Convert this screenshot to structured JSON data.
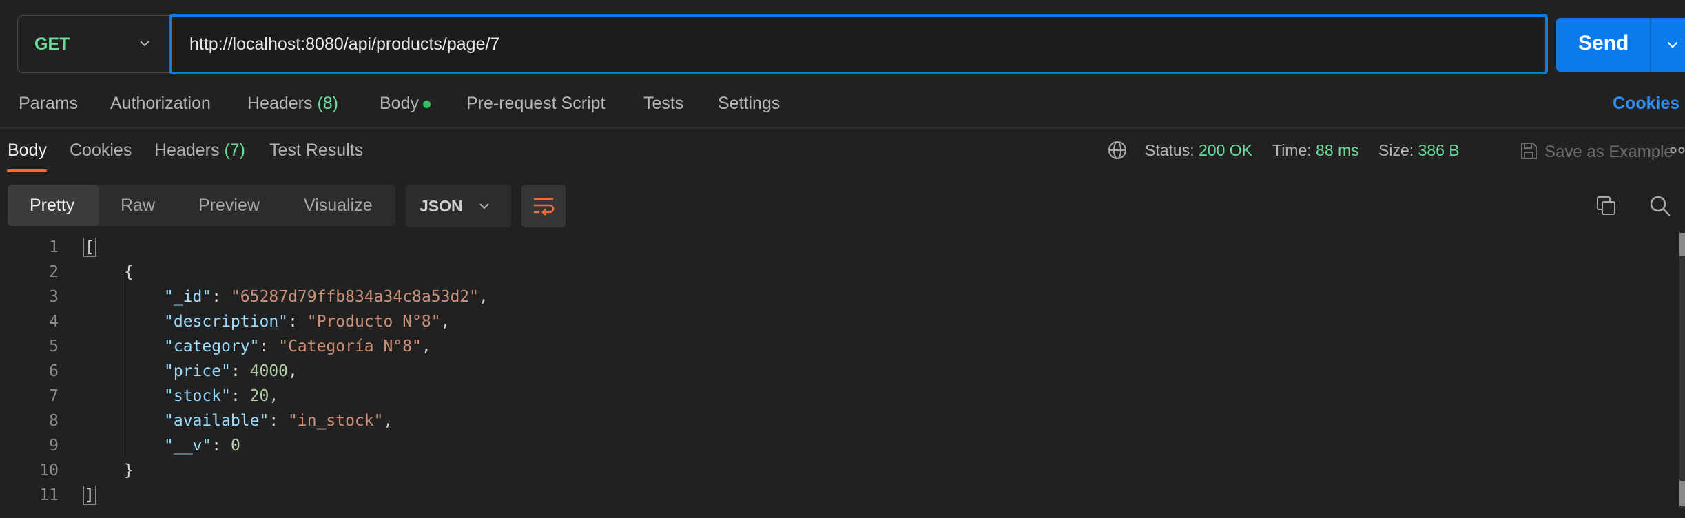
{
  "request": {
    "method": "GET",
    "url": "http://localhost:8080/api/products/page/7",
    "send_label": "Send",
    "tabs": [
      {
        "label": "Params"
      },
      {
        "label": "Authorization"
      },
      {
        "label": "Headers",
        "count": "(8)"
      },
      {
        "label": "Body"
      },
      {
        "label": "Pre-request Script"
      },
      {
        "label": "Tests"
      },
      {
        "label": "Settings"
      }
    ],
    "cookies_label": "Cookies"
  },
  "response": {
    "tabs": [
      {
        "label": "Body"
      },
      {
        "label": "Cookies"
      },
      {
        "label": "Headers",
        "count": "(7)"
      },
      {
        "label": "Test Results"
      }
    ],
    "status_label": "Status:",
    "status_value": "200 OK",
    "time_label": "Time:",
    "time_value": "88 ms",
    "size_label": "Size:",
    "size_value": "386 B",
    "save_example_label": "Save as Example",
    "views": [
      {
        "label": "Pretty"
      },
      {
        "label": "Raw"
      },
      {
        "label": "Preview"
      },
      {
        "label": "Visualize"
      }
    ],
    "format": "JSON"
  },
  "editor": {
    "line_numbers": [
      "1",
      "2",
      "3",
      "4",
      "5",
      "6",
      "7",
      "8",
      "9",
      "10",
      "11"
    ],
    "fields": {
      "id_key": "\"_id\"",
      "id_val": "\"65287d79ffb834a34c8a53d2\"",
      "desc_key": "\"description\"",
      "desc_val": "\"Producto N°8\"",
      "cat_key": "\"category\"",
      "cat_val": "\"Categoría N°8\"",
      "price_key": "\"price\"",
      "price_val": "4000",
      "stock_key": "\"stock\"",
      "stock_val": "20",
      "avail_key": "\"available\"",
      "avail_val": "\"in_stock\"",
      "v_key": "\"__v\"",
      "v_val": "0"
    }
  },
  "colors": {
    "accent": "#097bed",
    "status_green": "#6bdd9a",
    "active_tab_underline": "#f26b3a",
    "cookies_link": "#2f8ff5"
  },
  "icons": [
    "chevron-down-icon",
    "globe-icon",
    "save-icon",
    "more-icon",
    "copy-icon",
    "search-icon",
    "wrap-lines-icon"
  ]
}
